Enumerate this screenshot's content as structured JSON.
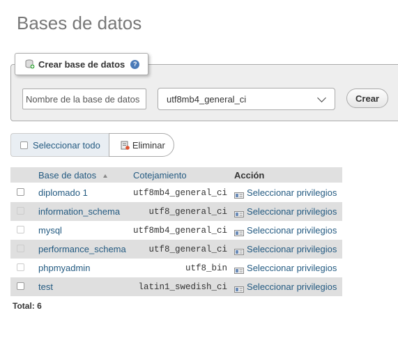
{
  "page": {
    "title": "Bases de datos"
  },
  "create": {
    "legend": "Crear base de datos",
    "name_placeholder": "Nombre de la base de datos",
    "collation": "utf8mb4_general_ci",
    "button": "Crear"
  },
  "actions": {
    "select_all": "Seleccionar todo",
    "delete": "Eliminar"
  },
  "table": {
    "headers": {
      "database": "Base de datos",
      "collation": "Cotejamiento",
      "action": "Acción"
    },
    "rows": [
      {
        "name": "diplomado 1",
        "collation": "utf8mb4_general_ci",
        "action": "Seleccionar privilegios",
        "checkbox_enabled": true
      },
      {
        "name": "information_schema",
        "collation": "utf8_general_ci",
        "action": "Seleccionar privilegios",
        "checkbox_enabled": false
      },
      {
        "name": "mysql",
        "collation": "utf8mb4_general_ci",
        "action": "Seleccionar privilegios",
        "checkbox_enabled": false
      },
      {
        "name": "performance_schema",
        "collation": "utf8_general_ci",
        "action": "Seleccionar privilegios",
        "checkbox_enabled": false
      },
      {
        "name": "phpmyadmin",
        "collation": "utf8_bin",
        "action": "Seleccionar privilegios",
        "checkbox_enabled": false
      },
      {
        "name": "test",
        "collation": "latin1_swedish_ci",
        "action": "Seleccionar privilegios",
        "checkbox_enabled": true
      }
    ]
  },
  "total": "Total: 6",
  "colors": {
    "link": "#235a81",
    "header_bg": "#e0e0e0",
    "alt_row_bg": "#dfdfdf",
    "help": "#4a7ab8"
  },
  "icons": [
    "database-add-icon",
    "help-icon",
    "chevron-down-icon",
    "delete-icon",
    "privileges-icon",
    "sort-asc-icon"
  ]
}
